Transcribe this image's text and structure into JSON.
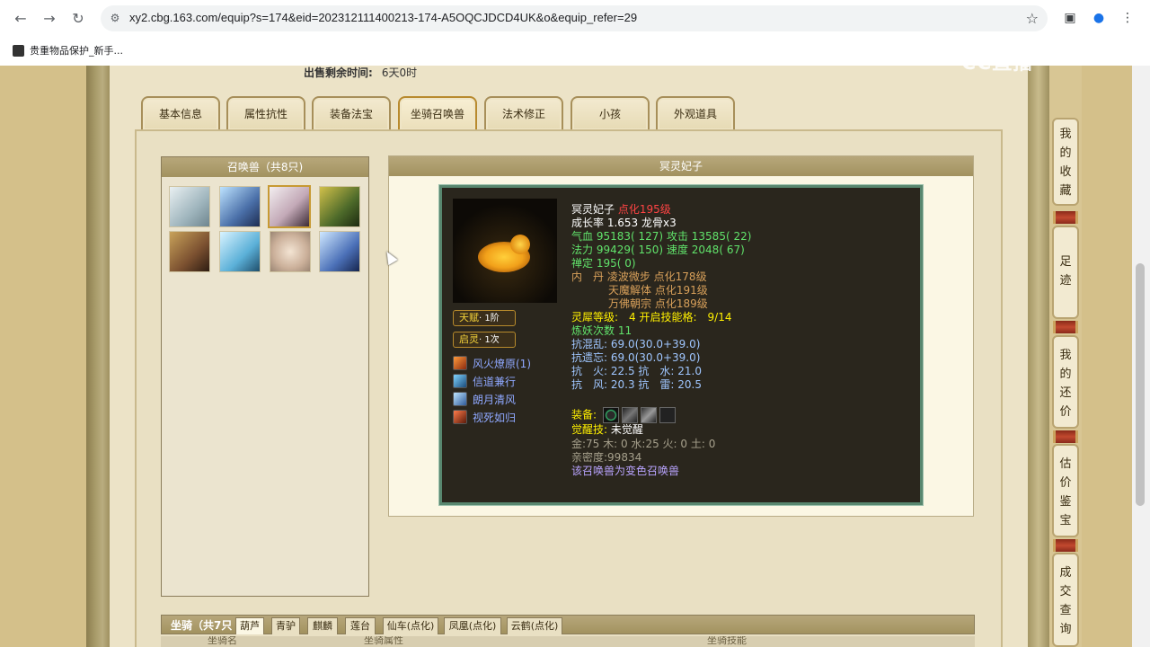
{
  "browser": {
    "url": "xy2.cbg.163.com/equip?s=174&eid=202312111400213-174-A5OQCJDCD4UK&o&equip_refer=29",
    "bookmark": "贵重物品保护_新手..."
  },
  "watermark": "CC直播",
  "sale": {
    "label": "出售剩余时间:",
    "value": "6天0时"
  },
  "tabs": [
    "基本信息",
    "属性抗性",
    "装备法宝",
    "坐骑召唤兽",
    "法术修正",
    "小孩",
    "外观道具"
  ],
  "pets_panel": {
    "title": "召唤兽（共8只)"
  },
  "detail": {
    "title": "冥灵妃子",
    "name": "冥灵妃子",
    "dianhua": "点化195级",
    "growth": "成长率 1.653 龙骨x3",
    "hp_label": "气血",
    "hp": "95183( 127)",
    "atk_label": "攻击",
    "atk": "13585( 22)",
    "mp_label": "法力",
    "mp": "99429( 150)",
    "spd_label": "速度",
    "spd": "2048( 67)",
    "chan_label": "禅定",
    "chan": "195( 0)",
    "neidan_label": "内　丹",
    "neidan": [
      "凌波微步 点化178级",
      "天魔解体 点化191级",
      "万佛朝宗 点化189级"
    ],
    "lingxi": "灵犀等级:　4 开启技能格:　9/14",
    "lianyao": "炼妖次数 11",
    "res1": "抗混乱: 69.0(30.0+39.0)",
    "res2": "抗遗忘: 69.0(30.0+39.0)",
    "res3": "抗　火: 22.5 抗　水: 21.0",
    "res4": "抗　风: 20.3 抗　雷: 20.5",
    "equip_label": "装备:",
    "awake_label": "觉醒技:",
    "awake_value": "未觉醒",
    "elements": "金:75 木: 0 水:25 火: 0 土: 0",
    "intimacy": "亲密度:99834",
    "variant": "该召唤兽为变色召唤兽",
    "talent_main": "天赋",
    "talent_sub": "· 1阶",
    "qiling_main": "启灵",
    "qiling_sub": "· 1次",
    "skills": [
      "风火燎原(1)",
      "信道兼行",
      "朗月清风",
      "视死如归"
    ]
  },
  "sidebar": [
    [
      "我",
      "的",
      "收",
      "藏"
    ],
    [
      "足",
      "迹"
    ],
    [
      "我",
      "的",
      "还",
      "价"
    ],
    [
      "估",
      "价",
      "鉴",
      "宝"
    ],
    [
      "成",
      "交",
      "查",
      "询"
    ]
  ],
  "mounts": {
    "title": "坐骑（共7只",
    "tabs": [
      "葫芦",
      "青驴",
      "麒麟",
      "莲台",
      "仙车(点化)",
      "凤凰(点化)",
      "云鹤(点化)"
    ],
    "headers": [
      "坐骑名",
      "坐骑属性",
      "坐骑技能"
    ]
  },
  "colors": {
    "accent_red": "#ff4444",
    "stat_green": "#61e36b",
    "highlight_yellow": "#fff000",
    "skill_blue": "#8fa8ff",
    "card_bg": "#2a261d",
    "card_border": "#58876f"
  }
}
